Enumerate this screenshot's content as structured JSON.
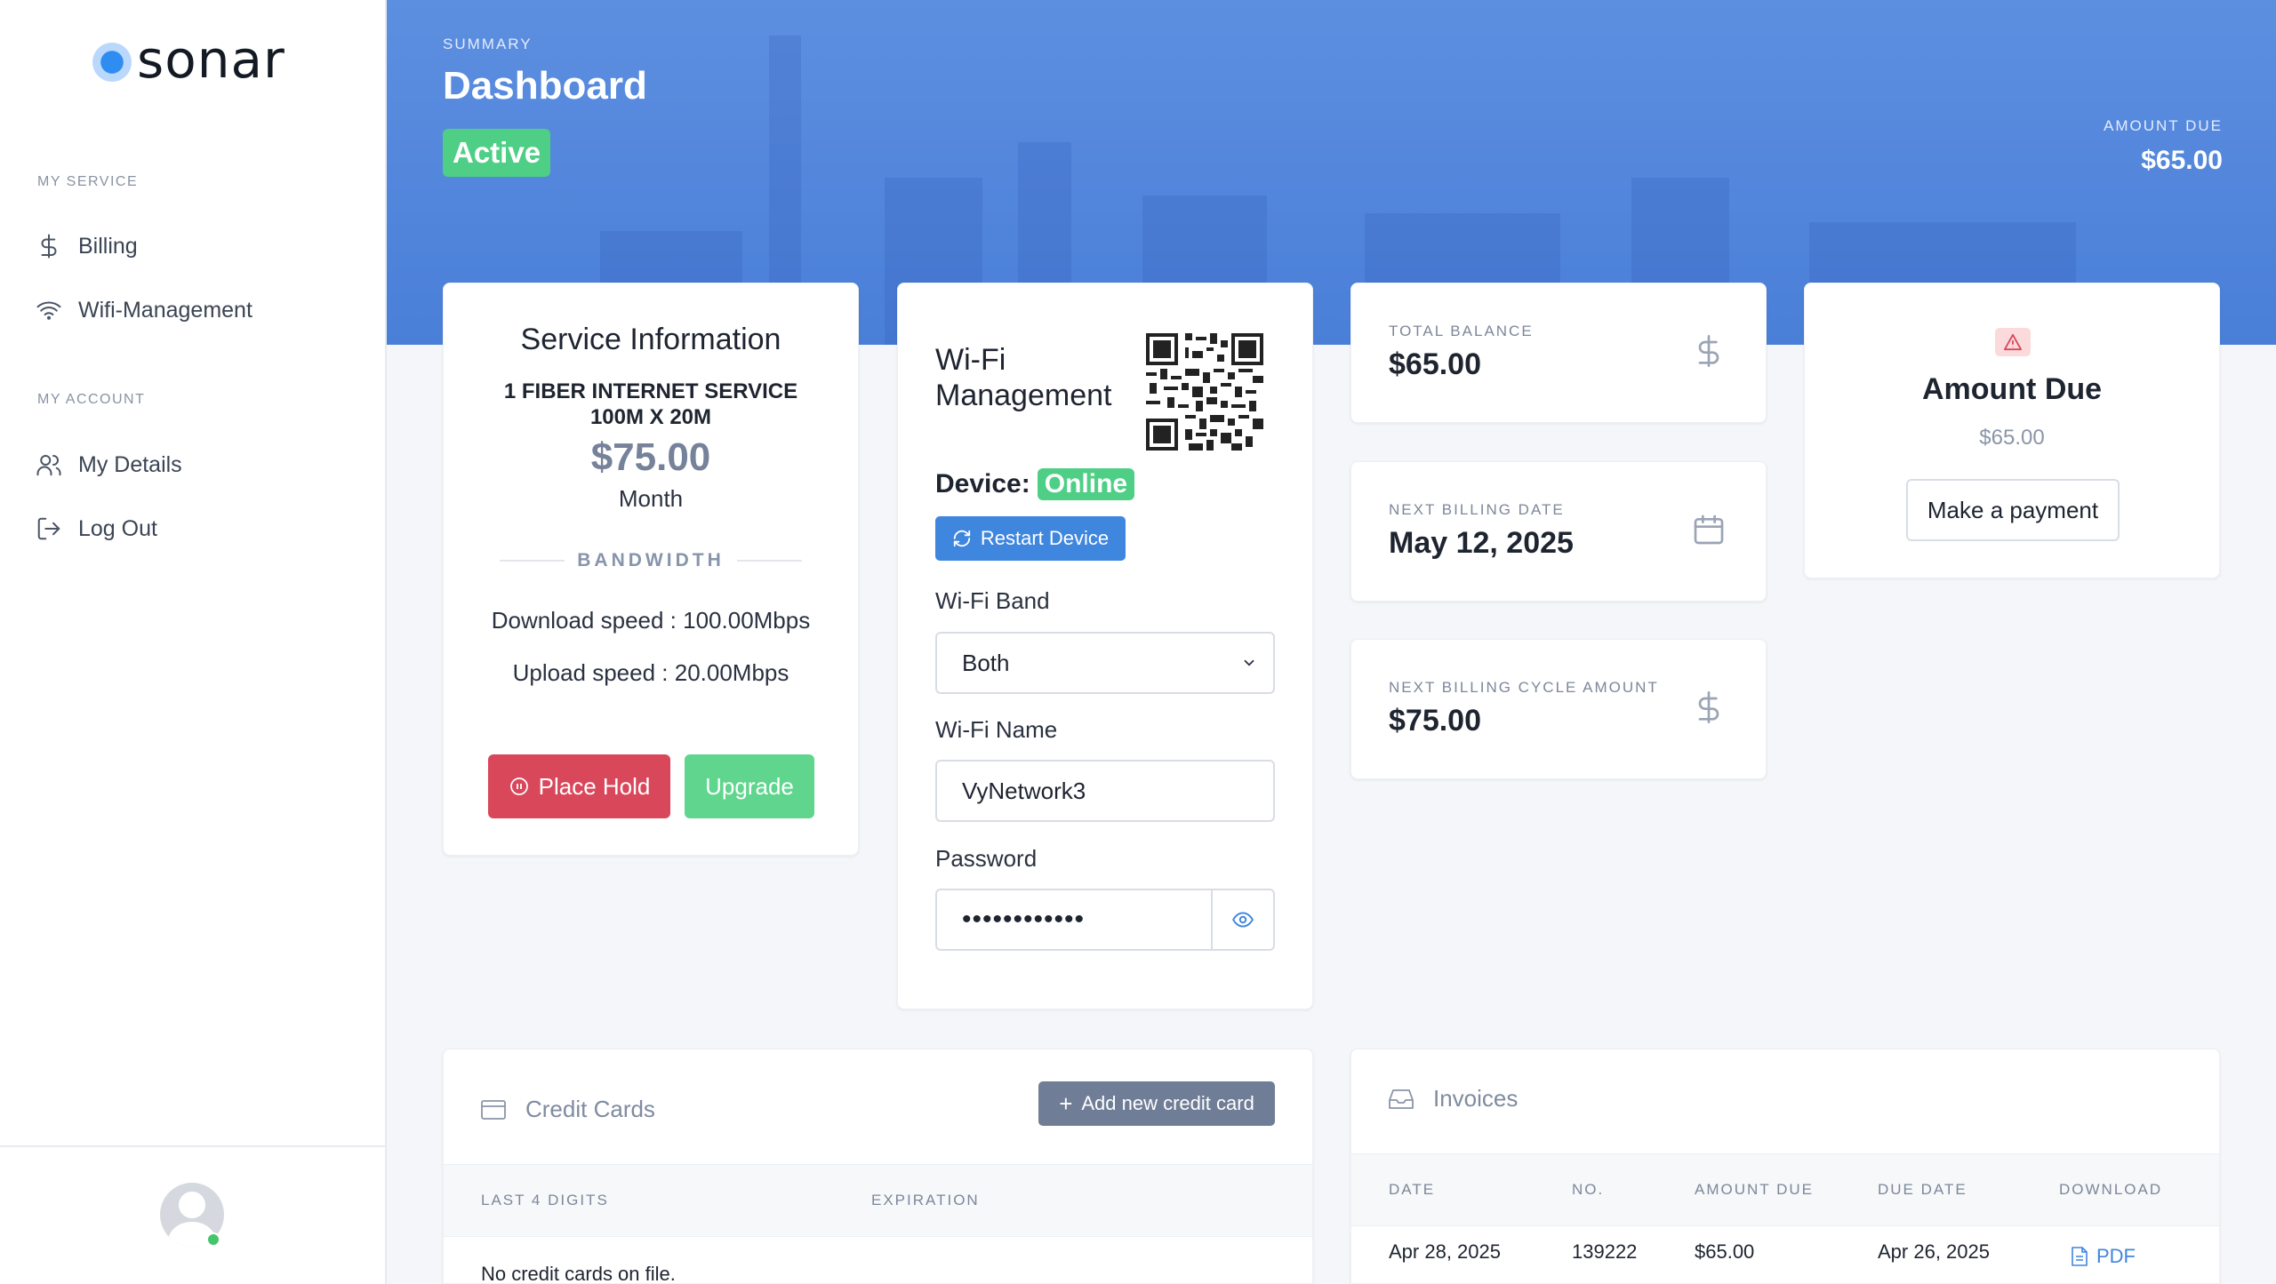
{
  "brand": {
    "name": "sonar"
  },
  "sidebar": {
    "section_service": "MY SERVICE",
    "section_account": "MY ACCOUNT",
    "items": [
      {
        "label": "Billing",
        "icon": "dollar-icon"
      },
      {
        "label": "Wifi-Management",
        "icon": "wifi-icon"
      },
      {
        "label": "My Details",
        "icon": "users-icon"
      },
      {
        "label": "Log Out",
        "icon": "logout-icon"
      }
    ]
  },
  "header": {
    "eyebrow": "SUMMARY",
    "title": "Dashboard",
    "status": "Active",
    "amount_due_label": "AMOUNT DUE",
    "amount_due_value": "$65.00"
  },
  "service": {
    "title": "Service Information",
    "plan_line1": "1 FIBER INTERNET SERVICE",
    "plan_line2": "100M X 20M",
    "price": "$75.00",
    "period": "Month",
    "bandwidth_label": "BANDWIDTH",
    "download": "Download speed : 100.00Mbps",
    "upload": "Upload speed : 20.00Mbps",
    "hold_label": "Place Hold",
    "upgrade_label": "Upgrade"
  },
  "wifi": {
    "title": "Wi-Fi Management",
    "device_label": "Device:",
    "device_status": "Online",
    "restart_label": "Restart Device",
    "band_label": "Wi-Fi Band",
    "band_value": "Both",
    "name_label": "Wi-Fi Name",
    "name_value": "VyNetwork3",
    "password_label": "Password",
    "password_value": "••••••••••••"
  },
  "stats": [
    {
      "label": "TOTAL BALANCE",
      "value": "$65.00",
      "icon": "dollar-icon"
    },
    {
      "label": "NEXT BILLING DATE",
      "value": "May 12, 2025",
      "icon": "calendar-icon"
    },
    {
      "label": "NEXT BILLING CYCLE AMOUNT",
      "value": "$75.00",
      "icon": "dollar-icon"
    }
  ],
  "due_card": {
    "title": "Amount Due",
    "amount": "$65.00",
    "button": "Make a payment"
  },
  "credit_cards": {
    "title": "Credit Cards",
    "add_label": "Add new credit card",
    "columns": [
      "LAST 4 DIGITS",
      "EXPIRATION"
    ],
    "empty_text": "No credit cards on file."
  },
  "invoices": {
    "title": "Invoices",
    "columns": [
      "DATE",
      "NO.",
      "AMOUNT DUE",
      "DUE DATE",
      "DOWNLOAD"
    ],
    "rows": [
      {
        "date": "Apr 28, 2025",
        "no": "139222",
        "amount": "$65.00",
        "due": "Apr 26, 2025",
        "download": "PDF"
      }
    ]
  },
  "colors": {
    "accent": "#3f86de",
    "success": "#4fcf86",
    "danger": "#d9475b",
    "hero": "#5d8fe0"
  }
}
